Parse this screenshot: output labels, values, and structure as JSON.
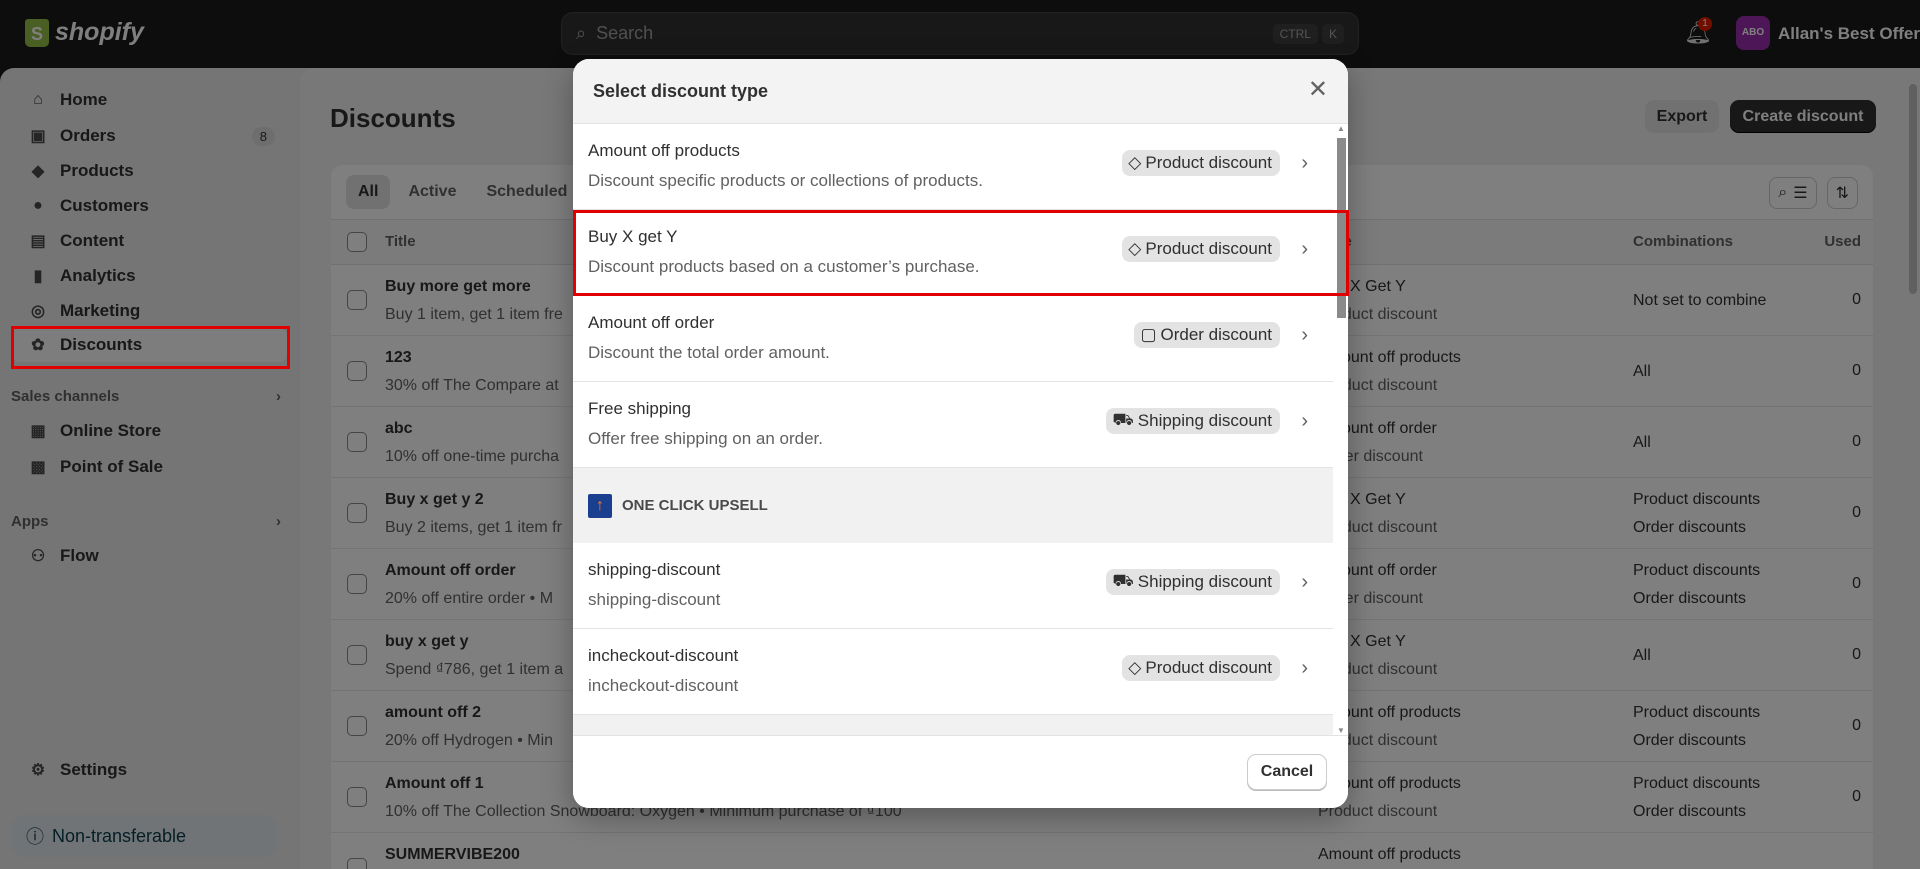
{
  "topbar": {
    "logo": "shopify",
    "search_placeholder": "Search",
    "shortcut_keys": [
      "CTRL",
      "K"
    ],
    "notification_count": "1",
    "avatar_initials": "ABO",
    "avatar_color": "#9b2fae",
    "store_name": "Allan's Best Offer"
  },
  "sidebar": {
    "items": [
      {
        "label": "Home",
        "icon": "home-icon"
      },
      {
        "label": "Orders",
        "icon": "inbox-icon",
        "count": "8"
      },
      {
        "label": "Products",
        "icon": "tag-icon"
      },
      {
        "label": "Customers",
        "icon": "person-icon"
      },
      {
        "label": "Content",
        "icon": "image-icon"
      },
      {
        "label": "Analytics",
        "icon": "bar-chart-icon"
      },
      {
        "label": "Marketing",
        "icon": "target-icon"
      },
      {
        "label": "Discounts",
        "icon": "discount-icon"
      }
    ],
    "sales_channels_label": "Sales channels",
    "sales_channels": [
      {
        "label": "Online Store",
        "icon": "store-icon"
      },
      {
        "label": "Point of Sale",
        "icon": "pos-icon"
      }
    ],
    "apps_label": "Apps",
    "apps": [
      {
        "label": "Flow",
        "icon": "flow-icon"
      }
    ],
    "settings_label": "Settings",
    "plan_notice": "Non-transferable"
  },
  "page": {
    "title": "Discounts",
    "export_label": "Export",
    "create_label": "Create discount",
    "tabs": [
      "All",
      "Active",
      "Scheduled"
    ],
    "columns": {
      "title": "Title",
      "type": "Type",
      "combinations": "Combinations",
      "used": "Used"
    },
    "rows": [
      {
        "title": "Buy more get more",
        "summary": "Buy 1 item, get 1 item fre",
        "type": "Buy X Get Y",
        "kind": "Product discount",
        "combinations": [
          "Not set to combine"
        ],
        "used": "0"
      },
      {
        "title": "123",
        "summary": "30% off The Compare at",
        "type": "Amount off products",
        "kind": "Product discount",
        "combinations": [
          "All"
        ],
        "used": "0"
      },
      {
        "title": "abc",
        "summary": "10% off one-time purcha",
        "type": "Amount off order",
        "kind": "Order discount",
        "combinations": [
          "All"
        ],
        "used": "0"
      },
      {
        "title": "Buy x get y 2",
        "summary": "Buy 2 items, get 1 item fr",
        "type": "Buy X Get Y",
        "kind": "Product discount",
        "combinations": [
          "Product discounts",
          "Order discounts"
        ],
        "used": "0"
      },
      {
        "title": "Amount off order",
        "summary": "20% off entire order • M",
        "type": "Amount off order",
        "kind": "Order discount",
        "combinations": [
          "Product discounts",
          "Order discounts"
        ],
        "used": "0"
      },
      {
        "title": "buy x get y",
        "summary": "Spend ₫786, get 1 item a",
        "type": "Buy X Get Y",
        "kind": "Product discount",
        "combinations": [
          "All"
        ],
        "used": "0"
      },
      {
        "title": "amount off 2",
        "summary": "20% off Hydrogen • Min",
        "type": "Amount off products",
        "kind": "Product discount",
        "combinations": [
          "Product discounts",
          "Order discounts"
        ],
        "used": "0"
      },
      {
        "title": "Amount off 1",
        "summary": "10% off The Collection Snowboard: Oxygen • Minimum purchase of ₫100",
        "type": "Amount off products",
        "kind": "Product discount",
        "combinations": [
          "Product discounts",
          "Order discounts"
        ],
        "used": "0"
      },
      {
        "title": "SUMMERVIBE200",
        "summary": "",
        "type": "Amount off products",
        "kind": "",
        "combinations": [],
        "used": ""
      }
    ]
  },
  "modal": {
    "title": "Select discount type",
    "options": [
      {
        "title": "Amount off products",
        "description": "Discount specific products or collections of products.",
        "badge": "Product discount",
        "badge_icon": "tag-icon"
      },
      {
        "title": "Buy X get Y",
        "description": "Discount products based on a customer’s purchase.",
        "badge": "Product discount",
        "badge_icon": "tag-icon",
        "highlighted": true
      },
      {
        "title": "Amount off order",
        "description": "Discount the total order amount.",
        "badge": "Order discount",
        "badge_icon": "cart-icon"
      },
      {
        "title": "Free shipping",
        "description": "Offer free shipping on an order.",
        "badge": "Shipping discount",
        "badge_icon": "truck-icon"
      }
    ],
    "app_section": "ONE CLICK UPSELL",
    "app_options": [
      {
        "title": "shipping-discount",
        "description": "shipping-discount",
        "badge": "Shipping discount",
        "badge_icon": "truck-icon"
      },
      {
        "title": "incheckout-discount",
        "description": "incheckout-discount",
        "badge": "Product discount",
        "badge_icon": "tag-icon"
      }
    ],
    "cancel_label": "Cancel"
  },
  "colors": {
    "highlight": "#e00000",
    "primary_button": "#303030",
    "topbar": "#1a1a1a"
  }
}
